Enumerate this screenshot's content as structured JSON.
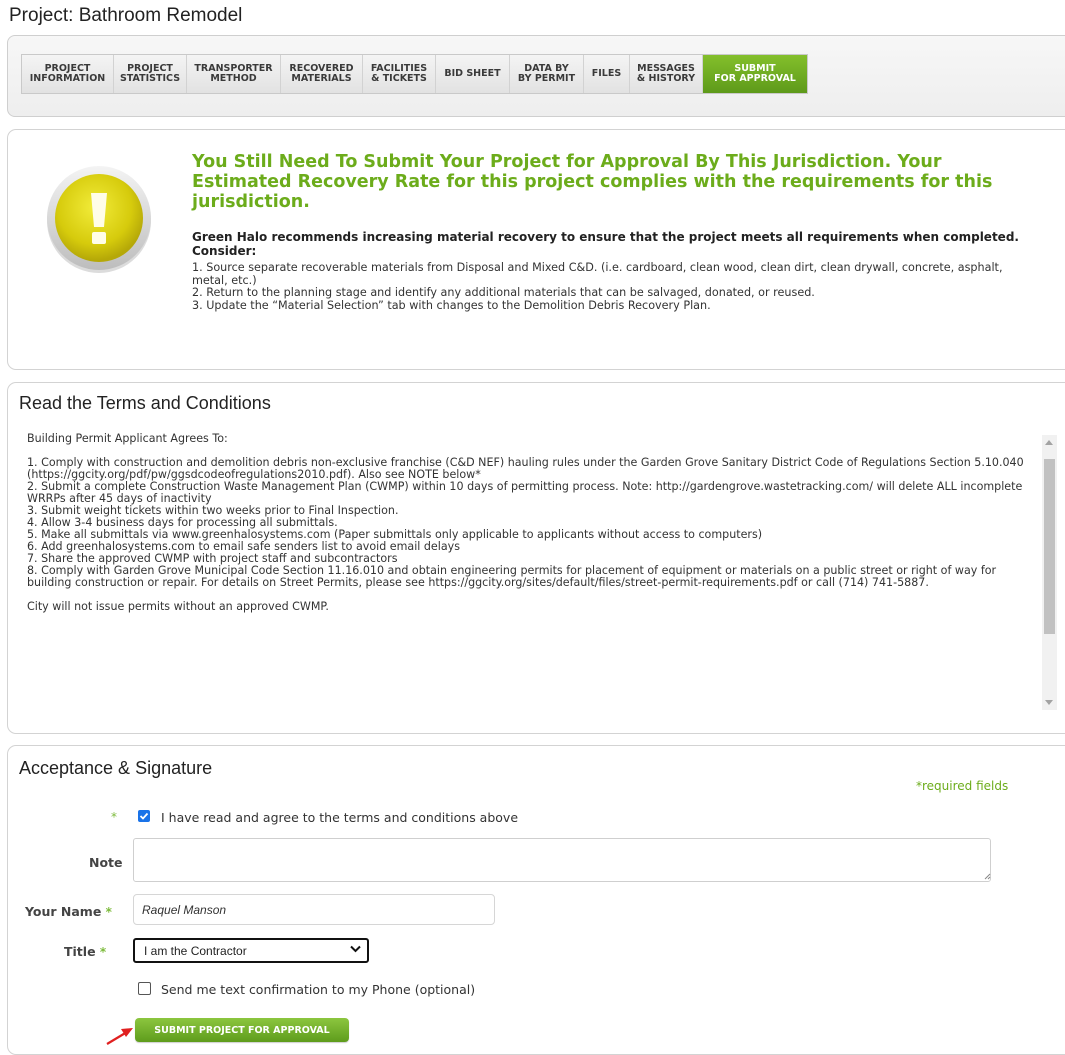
{
  "page": {
    "title": "Project: Bathroom Remodel"
  },
  "tabs": [
    {
      "label": "PROJECT\nINFORMATION",
      "active": false
    },
    {
      "label": "PROJECT\nSTATISTICS",
      "active": false
    },
    {
      "label": "TRANSPORTER\nMETHOD",
      "active": false
    },
    {
      "label": "RECOVERED\nMATERIALS",
      "active": false
    },
    {
      "label": "FACILITIES\n& TICKETS",
      "active": false
    },
    {
      "label": "BID SHEET",
      "active": false
    },
    {
      "label": "DATA BY\nBY PERMIT",
      "active": false
    },
    {
      "label": "FILES",
      "active": false
    },
    {
      "label": "MESSAGES\n& HISTORY",
      "active": false
    },
    {
      "label": "SUBMIT\nFOR APPROVAL",
      "active": true
    }
  ],
  "warning": {
    "icon": "exclamation-icon",
    "headline": "You Still Need To Submit Your Project for Approval By This Jurisdiction. Your Estimated Recovery Rate for this project complies with the requirements for this jurisdiction.",
    "recommendation": "Green Halo recommends increasing material recovery to ensure that the project meets all requirements when completed. Consider:",
    "items": [
      "1. Source separate recoverable materials from Disposal and Mixed C&D. (i.e. cardboard, clean wood, clean dirt, clean drywall, concrete, asphalt, metal, etc.)",
      "2. Return to the planning stage and identify any additional materials that can be salvaged, donated, or reused.",
      "3. Update the “Material Selection” tab with changes to the Demolition Debris Recovery Plan."
    ]
  },
  "terms": {
    "title": "Read the Terms and Conditions",
    "intro": "Building Permit Applicant Agrees To:",
    "items": [
      "1. Comply with construction and demolition debris non-exclusive franchise (C&D NEF) hauling rules under the Garden Grove Sanitary District Code of Regulations Section 5.10.040 (https://ggcity.org/pdf/pw/ggsdcodeofregulations2010.pdf). Also see NOTE below*",
      "2. Submit a complete Construction Waste Management Plan (CWMP) within 10 days of permitting process. Note: http://gardengrove.wastetracking.com/ will delete ALL incomplete WRRPs after 45 days of inactivity",
      "3. Submit weight tickets within two weeks prior to Final Inspection.",
      "4. Allow 3-4 business days for processing all submittals.",
      "5. Make all submittals via www.greenhalosystems.com (Paper submittals only applicable to applicants without access to computers)",
      "6. Add greenhalosystems.com to email safe senders list to avoid email delays",
      "7. Share the approved CWMP with project staff and subcontractors",
      "8. Comply with Garden Grove Municipal Code Section 11.16.010 and obtain engineering permits for placement of equipment or materials on a public street or right of way for building construction or repair. For details on Street Permits, please see https://ggcity.org/sites/default/files/street-permit-requirements.pdf or call (714) 741-5887."
    ],
    "closing": "City will not issue permits without an approved CWMP."
  },
  "acceptance": {
    "title": "Acceptance & Signature",
    "required_note": "*required fields",
    "required_mark": "*",
    "agree_label": "I have read and agree to the terms and conditions above",
    "agree_checked": true,
    "note_label": "Note",
    "note_value": "",
    "name_label": "Your Name",
    "name_value": "Raquel Manson",
    "title_label": "Title",
    "title_value": "I am the Contractor",
    "sms_label": "Send me text confirmation to my Phone (optional)",
    "sms_checked": false,
    "submit_label": "SUBMIT PROJECT FOR APPROVAL"
  },
  "colors": {
    "accent_green": "#6cac1b",
    "active_tab": "#6fae22",
    "checkbox_blue": "#1a73e8",
    "annotation_red": "#e02020"
  }
}
